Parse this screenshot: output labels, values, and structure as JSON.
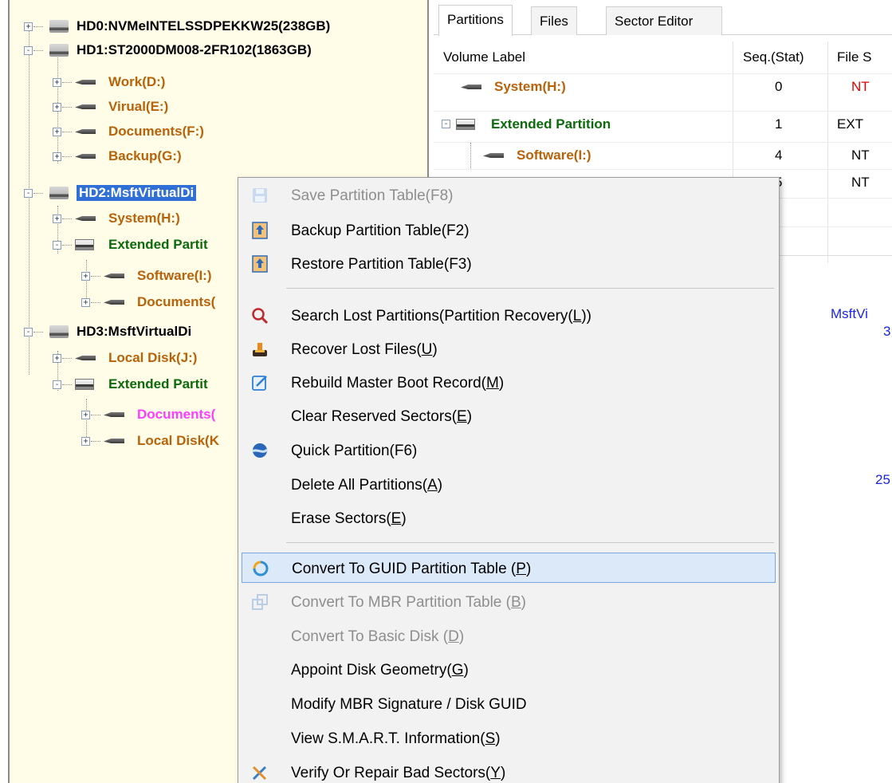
{
  "tree": {
    "disks": [
      {
        "label": "HD0:NVMeINTELSSDPEKKW25(238GB)",
        "expander": "+"
      },
      {
        "label": "HD1:ST2000DM008-2FR102(1863GB)",
        "expander": "-"
      },
      {
        "label": "HD2:MsftVirtualDi",
        "expander": "-"
      },
      {
        "label": "HD3:MsftVirtualDi",
        "expander": "-"
      }
    ],
    "hd1_partitions": [
      "Work(D:)",
      "Virual(E:)",
      "Documents(F:)",
      "Backup(G:)"
    ],
    "hd2_items": {
      "system": "System(H:)",
      "extended": "Extended Partit",
      "logical": [
        "Software(I:)",
        "Documents("
      ]
    },
    "hd3_items": {
      "local": "Local Disk(J:)",
      "extended": "Extended Partit",
      "logical": [
        "Documents(",
        "Local Disk(K"
      ]
    },
    "expander_plus": "+",
    "expander_minus": "-"
  },
  "tabs": [
    "Partitions",
    "Files",
    "Sector Editor"
  ],
  "grid": {
    "columns": [
      "Volume Label",
      "Seq.(Stat)",
      "File S"
    ],
    "rows": [
      {
        "label": "System(H:)",
        "seq": "0",
        "fs": "NT"
      },
      {
        "label": "Extended Partition",
        "seq": "1",
        "fs": "EXT"
      },
      {
        "label": "Software(I:)",
        "seq": "4",
        "fs": "NT"
      },
      {
        "label": "",
        "seq": "5",
        "fs": "NT"
      }
    ]
  },
  "info": {
    "disk_name": "MsftVi",
    "disk_sub": "3",
    "capacity": "25"
  },
  "menu": {
    "items": [
      {
        "label": "Save Partition Table(F8)",
        "icon": "save-icon",
        "disabled": true
      },
      {
        "label": "Backup Partition Table(F2)",
        "icon": "backup-table-icon",
        "disabled": false
      },
      {
        "label": "Restore Partition Table(F3)",
        "icon": "restore-table-icon",
        "disabled": false
      },
      {
        "label_pre": "Search Lost Partitions(Partition Recovery(",
        "key": "L",
        "label_post": ")",
        "icon": "search-icon",
        "disabled": false
      },
      {
        "label_pre": "Recover Lost Files(",
        "key": "U",
        "label_post": ")",
        "icon": "recover-files-icon",
        "disabled": false
      },
      {
        "label_pre": "Rebuild Master Boot Record(",
        "key": "M",
        "label_post": ")",
        "icon": "rebuild-mbr-icon",
        "disabled": false
      },
      {
        "label_pre": "Clear Reserved Sectors(",
        "key": "E",
        "label_post": ")",
        "icon": "",
        "disabled": false
      },
      {
        "label": "Quick Partition(F6)",
        "icon": "quick-partition-icon",
        "disabled": false
      },
      {
        "label_pre": "Delete All Partitions(",
        "key": "A",
        "label_post": ")",
        "icon": "",
        "disabled": false
      },
      {
        "label_pre": "Erase Sectors(",
        "key": "E",
        "label_post": ")",
        "icon": "",
        "disabled": false
      },
      {
        "label_pre": "Convert To GUID Partition Table (",
        "key": "P",
        "label_post": ")",
        "icon": "convert-guid-icon",
        "disabled": false,
        "highlighted": true
      },
      {
        "label_pre": "Convert To MBR Partition Table (",
        "key": "B",
        "label_post": ")",
        "icon": "convert-mbr-icon",
        "disabled": true
      },
      {
        "label_pre": "Convert To Basic Disk (",
        "key": "D",
        "label_post": ")",
        "icon": "",
        "disabled": true
      },
      {
        "label_pre": "Appoint Disk Geometry(",
        "key": "G",
        "label_post": ")",
        "icon": "",
        "disabled": false
      },
      {
        "label": "Modify MBR Signature / Disk GUID",
        "icon": "",
        "disabled": false
      },
      {
        "label_pre": "View S.M.A.R.T. Information(",
        "key": "S",
        "label_post": ")",
        "icon": "",
        "disabled": false
      },
      {
        "label_pre": "Verify Or Repair Bad Sectors(",
        "key": "Y",
        "label_post": ")",
        "icon": "repair-tools-icon",
        "disabled": false
      }
    ]
  },
  "colors": {
    "tree_bg": "#fffde8",
    "partition_label": "#b8620a",
    "extended_label": "#0b6b0b",
    "highlight_pink": "#ff3dff",
    "selection": "#2f6fd6",
    "ntfs_red": "#e00000",
    "info_blue": "#1a24e8",
    "menu_hover": "#dce9f8"
  }
}
